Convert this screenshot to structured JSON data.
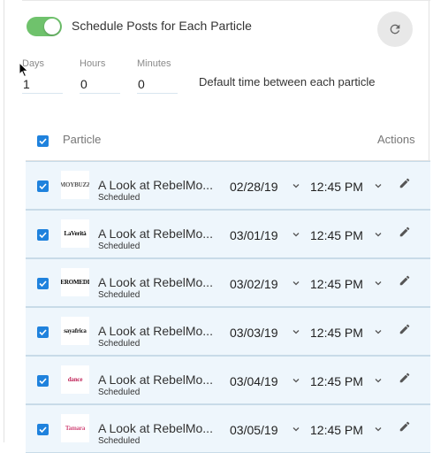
{
  "schedule": {
    "toggle_label": "Schedule Posts for Each Particle",
    "toggle_on": true
  },
  "fields": {
    "days_label": "Days",
    "days_value": "1",
    "hours_label": "Hours",
    "hours_value": "0",
    "minutes_label": "Minutes",
    "minutes_value": "0",
    "default_text": "Default time between each particle"
  },
  "table": {
    "col_particle": "Particle",
    "col_actions": "Actions",
    "rows": [
      {
        "thumb_text": "MOYBUZZ",
        "thumb_color": "#555555",
        "title": "A Look at RebelMo...",
        "status": "Scheduled",
        "date": "02/28/19",
        "time": "12:45 PM"
      },
      {
        "thumb_text": "LaVerità",
        "thumb_color": "#000000",
        "title": "A Look at RebelMo...",
        "status": "Scheduled",
        "date": "03/01/19",
        "time": "12:45 PM"
      },
      {
        "thumb_text": "ZEROMEDIA",
        "thumb_color": "#000000",
        "title": "A Look at RebelMo...",
        "status": "Scheduled",
        "date": "03/02/19",
        "time": "12:45 PM"
      },
      {
        "thumb_text": "sayafrica",
        "thumb_color": "#111111",
        "title": "A Look at RebelMo...",
        "status": "Scheduled",
        "date": "03/03/19",
        "time": "12:45 PM"
      },
      {
        "thumb_text": "dance",
        "thumb_color": "#c0265a",
        "title": "A Look at RebelMo...",
        "status": "Scheduled",
        "date": "03/04/19",
        "time": "12:45 PM"
      },
      {
        "thumb_text": "Tamara",
        "thumb_color": "#d24a7a",
        "title": "A Look at RebelMo...",
        "status": "Scheduled",
        "date": "03/05/19",
        "time": "12:45 PM"
      }
    ]
  },
  "colors": {
    "toggle_on": "#6fc26c",
    "checkbox": "#1f82dd",
    "row_bg": "#eef6fc"
  }
}
